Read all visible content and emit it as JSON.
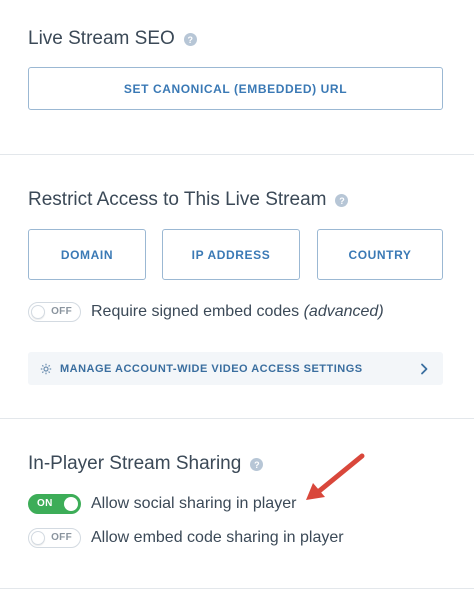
{
  "seo": {
    "heading": "Live Stream SEO",
    "canonical_button": "SET CANONICAL (EMBEDDED) URL"
  },
  "restrict": {
    "heading": "Restrict Access to This Live Stream",
    "buttons": [
      "DOMAIN",
      "IP ADDRESS",
      "COUNTRY"
    ],
    "signed_toggle_state": "OFF",
    "signed_label_main": "Require signed embed codes",
    "signed_label_note": "(advanced)",
    "manage_link": "MANAGE ACCOUNT-WIDE VIDEO ACCESS SETTINGS"
  },
  "sharing": {
    "heading": "In-Player Stream Sharing",
    "social_toggle_state": "ON",
    "social_label": "Allow social sharing in player",
    "embed_toggle_state": "OFF",
    "embed_label": "Allow embed code sharing in player"
  },
  "help_glyph": "?",
  "colors": {
    "accent_text": "#3a79b5",
    "outline": "#9bb8d3",
    "toggle_on": "#3dad58",
    "annotation_arrow": "#d9473b"
  },
  "icons": [
    "help-icon",
    "gear-icon",
    "chevron-right-icon",
    "annotation-arrow"
  ]
}
